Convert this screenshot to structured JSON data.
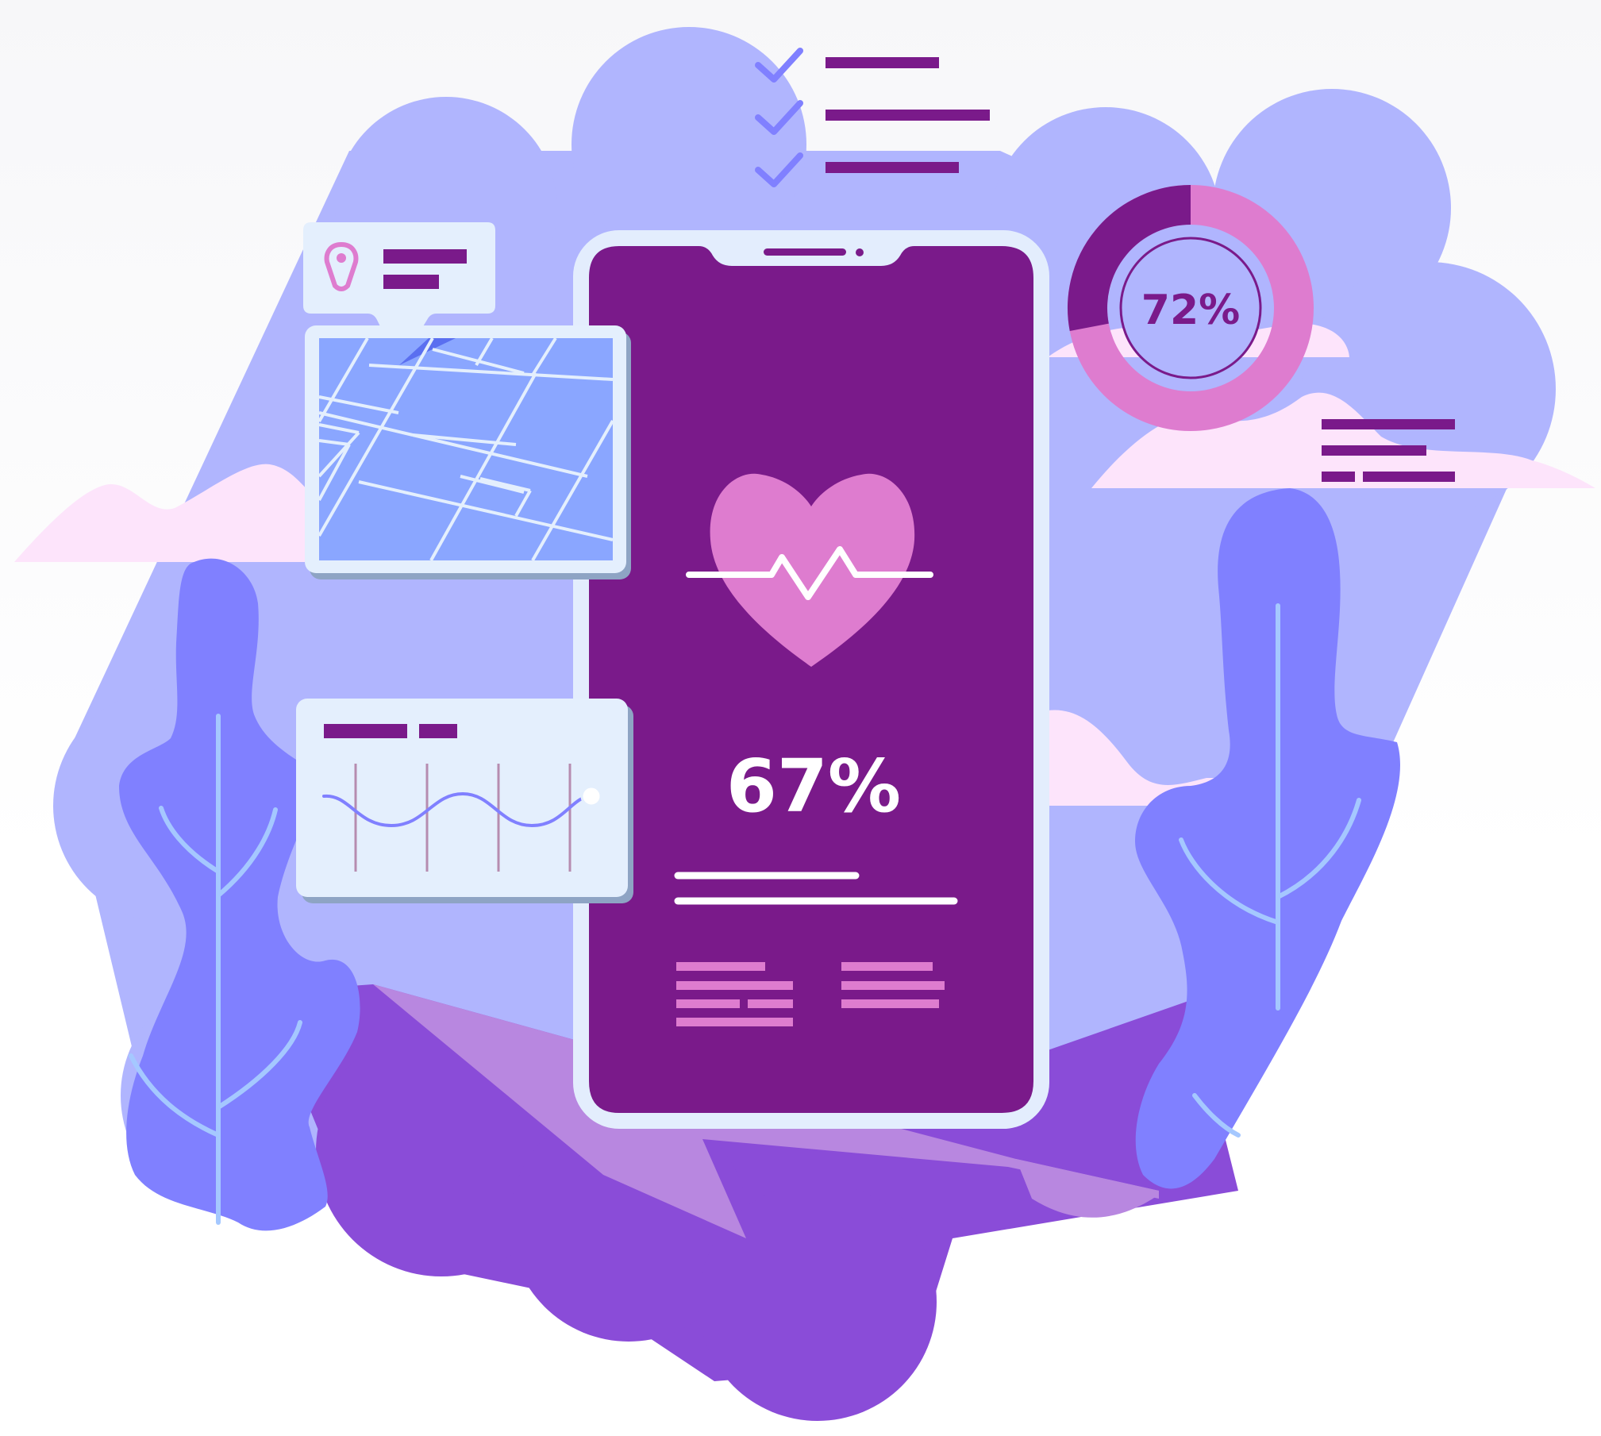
{
  "phone": {
    "main_percent": "67%"
  },
  "donut": {
    "label": "72%",
    "value_percent": 72
  },
  "colors": {
    "backdrop": "#b0b5fe",
    "phone_screen": "#7a1a8a",
    "phone_frame": "#e3edfd",
    "heart": "#de7ccf",
    "map_bg": "#8aa6ff",
    "card_bg": "#e4effd",
    "accent_dark": "#7a1a8a",
    "accent_pink": "#de7ccf",
    "tree": "#8080ff",
    "ground_dark": "#8a4cd8",
    "ground_light": "#b887e0",
    "cloud": "#fde4fb"
  },
  "icons": [
    "check-icon",
    "location-pin-icon",
    "heart-icon",
    "pulse-line-icon",
    "map-icon",
    "wave-chart-icon",
    "donut-chart-icon"
  ]
}
